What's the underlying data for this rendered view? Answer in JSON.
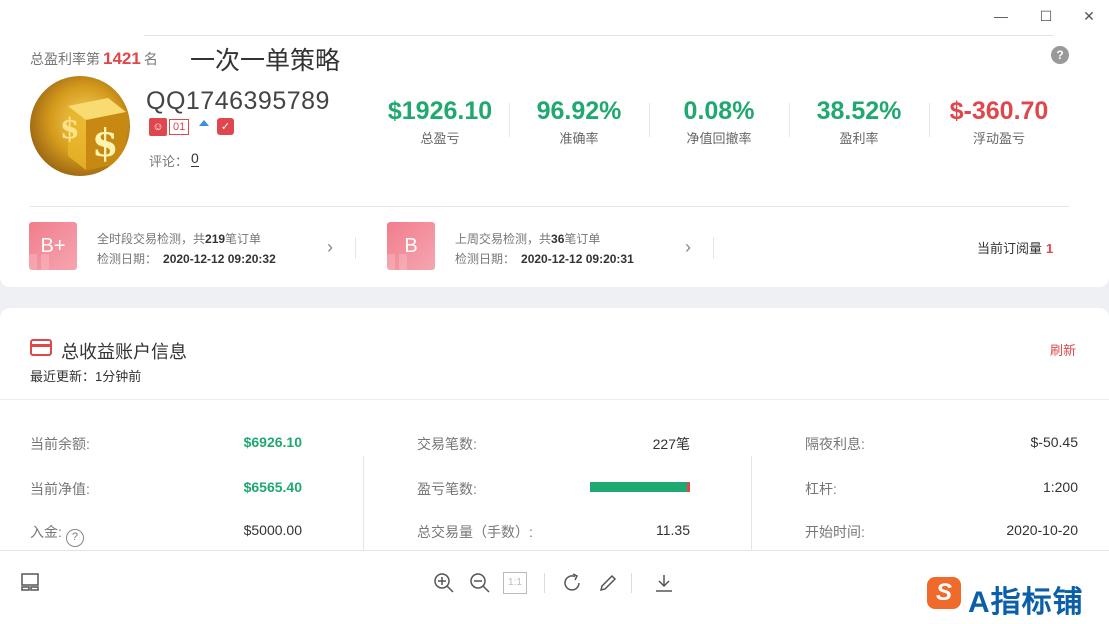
{
  "window": {
    "minimize": "—",
    "maximize": "☐",
    "close": "✕"
  },
  "header": {
    "rank_prefix": "总盈利率第",
    "rank_number": "1421",
    "rank_suffix": "名",
    "strategy_name": "一次一单策略",
    "help": "?"
  },
  "profile": {
    "username": "QQ1746395789",
    "badge_icon": "user-icon",
    "level": "01",
    "comment_label": "评论：",
    "comment_count": "0"
  },
  "stats": [
    {
      "value": "$1926.10",
      "label": "总盈亏",
      "color": "#1fa86f"
    },
    {
      "value": "96.92%",
      "label": "准确率",
      "color": "#1fa86f"
    },
    {
      "value": "0.08%",
      "label": "净值回撤率",
      "color": "#1fa86f"
    },
    {
      "value": "38.52%",
      "label": "盈利率",
      "color": "#1fa86f"
    },
    {
      "value": "$-360.70",
      "label": "浮动盈亏",
      "color": "#e0474c"
    }
  ],
  "detections": [
    {
      "grade": "B+",
      "line1_prefix": "全时段交易检测，共",
      "line1_count": "219",
      "line1_suffix": "笔订单",
      "date_label": "检测日期：",
      "date": "2020-12-12 09:20:32"
    },
    {
      "grade": "B",
      "line1_prefix": "上周交易检测，共",
      "line1_count": "36",
      "line1_suffix": "笔订单",
      "date_label": "检测日期：",
      "date": "2020-12-12 09:20:31"
    }
  ],
  "subscription": {
    "label": "当前订阅量",
    "count": "1"
  },
  "account": {
    "title": "总收益账户信息",
    "refresh": "刷新",
    "updated": "最近更新：1分钟前",
    "col1": [
      {
        "label": "当前余额:",
        "value": "$6926.10"
      },
      {
        "label": "当前净值:",
        "value": "$6565.40"
      },
      {
        "label": "入金:",
        "value": "$5000.00"
      }
    ],
    "col2": [
      {
        "label": "交易笔数:",
        "value": "227笔"
      },
      {
        "label": "盈亏笔数:",
        "win_ratio": 0.97
      },
      {
        "label": "总交易量（手数）:",
        "value": "11.35"
      }
    ],
    "col3": [
      {
        "label": "隔夜利息:",
        "value": "$-50.45"
      },
      {
        "label": "杠杆:",
        "value": "1:200"
      },
      {
        "label": "开始时间:",
        "value": "2020-10-20"
      }
    ]
  },
  "toolbar": {
    "icons": [
      "layout-icon",
      "zoom-in-icon",
      "zoom-out-icon",
      "actual-size-icon",
      "rotate-icon",
      "edit-icon",
      "download-icon"
    ],
    "actual_size": "1:1",
    "logo_letter": "S",
    "logo_text": "A指标铺"
  }
}
